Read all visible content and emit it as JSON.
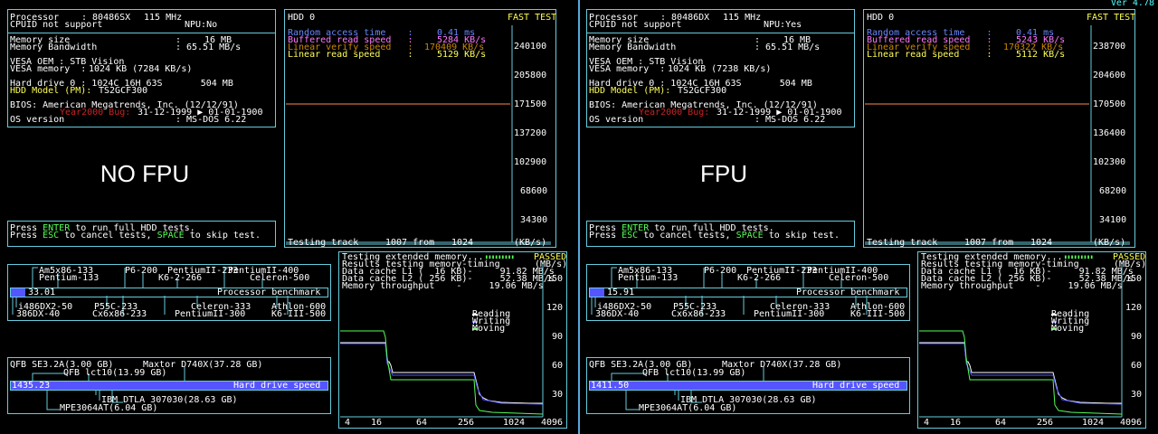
{
  "version": "Ver 4.78",
  "panels": [
    {
      "big_label": "NO FPU",
      "processor": "80486SX",
      "mhz": "115 MHz",
      "npu": "NPU:No",
      "mem_size": "16 MB",
      "mem_bw": "65.51 MB/s",
      "vesa_mem": "1024 KB (7284 KB/s)",
      "hdd_model": "TS2GCF300",
      "rand": "0.41 ms",
      "buf": "5284 KB/s",
      "lin_ver": "170409 KB/s",
      "lin_read": "5129 KB/s",
      "yaxis": [
        "240100",
        "205800",
        "171500",
        "137200",
        "102900",
        "68600",
        "34300"
      ],
      "cpu_val": "33.01",
      "hdd_val": "1435.23"
    },
    {
      "big_label": "FPU",
      "processor": "80486DX",
      "mhz": "115 MHz",
      "npu": "NPU:Yes",
      "mem_size": "16 MB",
      "mem_bw": "65.51 MB/s",
      "vesa_mem": "1024 KB (7238 KB/s)",
      "hdd_model": "TS2GCF300",
      "rand": "0.41 ms",
      "buf": "5243 KB/s",
      "lin_ver": "170322 KB/s",
      "lin_read": "5112 KB/s",
      "yaxis": [
        "238700",
        "204600",
        "170500",
        "136400",
        "102300",
        "68200",
        "34100"
      ],
      "cpu_val": "15.91",
      "hdd_val": "1411.50"
    }
  ],
  "common": {
    "processor_label": "Processor",
    "cpuid": "CPUID not support",
    "mem_size_label": "Memory size",
    "mem_bw_label": "Memory Bandwidth",
    "vesa_oem": "VESA OEM : STB Vision",
    "vesa_mem_label": "VESA memory  :",
    "hdd0_line": "Hard drive 0 : 1024C 16H 63S       504 MB",
    "hdd_model_label": "HDD Model (PM):",
    "bios": "BIOS: American Megatrends, Inc. (12/12/91)",
    "y2k_label": "Year2000 Bug:",
    "y2k_val": "31-12-1999 ▶ 01-01-1900",
    "os_label": "OS version",
    "os_val": ": MS-DOS 6.22",
    "press1a": "Press ",
    "press1b": "ENTER",
    "press1c": " to run full HDD tests.",
    "press2a": "Press ",
    "press2b": "ESC",
    "press2c": " to cancel tests, ",
    "press2d": "SPACE",
    "press2e": " to skip test.",
    "hdd_title": "HDD 0",
    "fast_test": "FAST TEST",
    "rand_label": "Random access time    :",
    "buf_label": "Buffered read speed   :",
    "lin_ver_label": "Linear verify speed   :",
    "lin_read_label": "Linear read speed     :",
    "track_line": "Testing track",
    "track_from": "1007 from",
    "track_total": "1024",
    "track_unit": "(KB/s)",
    "cpu_names_top1": "Am5x86-133",
    "cpu_names_top2": "P6-200",
    "cpu_names_top3": "PentiumII-233",
    "cpu_names_top4": "PentiumII-400",
    "cpu_names_top5": "Pentium-133",
    "cpu_names_top6": "K6-2-266",
    "cpu_names_top7": "Celeron-500",
    "cpu_bench_label": "Processor benchmark",
    "cpu_names_bot1": "i486DX2-50",
    "cpu_names_bot2": "P55C-233",
    "cpu_names_bot3": "Celeron-333",
    "cpu_names_bot4": "Athlon-600",
    "cpu_names_bot5": "386DX-40",
    "cpu_names_bot6": "Cx6x86-233",
    "cpu_names_bot7": "PentiumII-300",
    "cpu_names_bot8": "K6-III-500",
    "hdd_top1": "QFB SE3.2A(3.00 GB)",
    "hdd_top2": "Maxtor D740X(37.28 GB)",
    "hdd_top3": "QFB lct10(13.99 GB)",
    "hdd_bench_label": "Hard drive speed",
    "hdd_bot1": "IBM DTLA 307030(28.63 GB)",
    "hdd_bot2": "MPE3064AT(6.04 GB)",
    "mem_test": "Testing extended memory...",
    "passed": "PASSED",
    "mem_timing": "Results testing memory-timing",
    "mbs": "(MB/s)",
    "l1": "Data cache L1 (  16 KB)-     91.82 MB/s",
    "l2": "Data cache L2 ( 256 KB)-     52.38 MB/s",
    "thr": "Memory throughput    -     19.06 MB/s",
    "leg_read": "Reading",
    "leg_write": "Writing",
    "leg_move": "Moving",
    "mem_y": [
      "150",
      "120",
      "90",
      "60",
      "30"
    ],
    "mem_x": [
      "4",
      "16",
      "64",
      "256",
      "1024",
      "4096"
    ]
  },
  "colors": {
    "border": "#66ccdd",
    "accent": "#ffff55",
    "bar": "#5555ff",
    "line": "#ff8844"
  }
}
